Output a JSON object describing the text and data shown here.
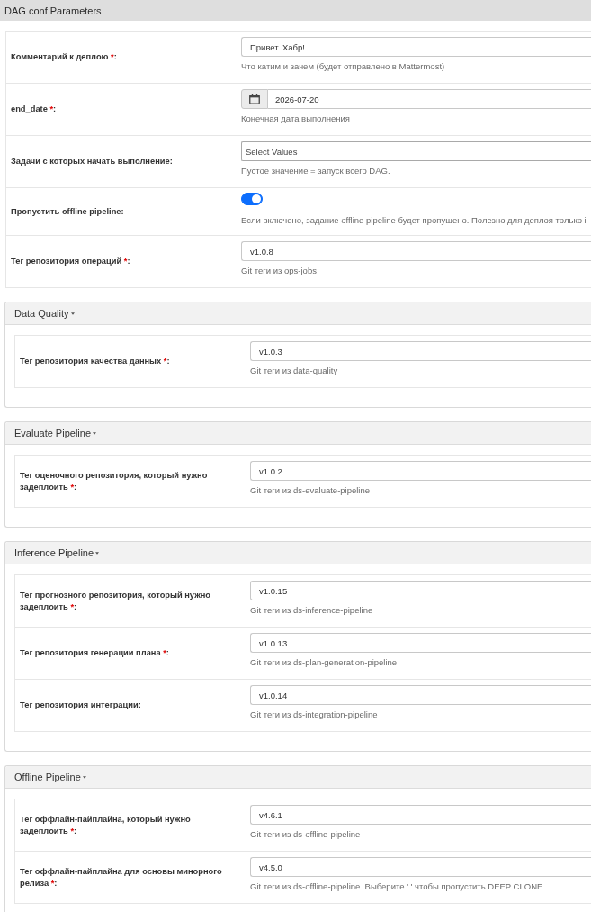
{
  "title": "DAG conf Parameters",
  "fields": [
    {
      "label": "Комментарий к деплою",
      "required_mark": "*",
      "colon": ":",
      "kind": "text",
      "value": "Привет. Хабр!",
      "hint": "Что катим и зачем (будет отправлено в Mattermost)"
    },
    {
      "label": "end_date",
      "required_mark": "*",
      "colon": ":",
      "kind": "date",
      "value": "2026-07-20",
      "hint": "Конечная дата выполнения"
    },
    {
      "label": "Задачи с которых начать выполнение",
      "colon": ":",
      "kind": "select",
      "placeholder": "Select Values",
      "hint": "Пустое значение = запуск всего DAG."
    },
    {
      "label": "Пропустить offline pipeline",
      "colon": ":",
      "kind": "toggle",
      "on": true,
      "hint": "Если включено, задание offline pipeline будет пропущено. Полезно для деплоя только i"
    },
    {
      "label": "Тег репозитория операций",
      "required_mark": "*",
      "colon": ":",
      "kind": "text",
      "value": "v1.0.8",
      "hint": "Git теги из ops-jobs"
    }
  ],
  "sections": [
    {
      "title": "Data Quality",
      "expanded": true,
      "fields": [
        {
          "label": "Тег репозитория качества данных",
          "required_mark": "*",
          "colon": ":",
          "kind": "text",
          "value": "v1.0.3",
          "hint": "Git теги из data-quality"
        }
      ]
    },
    {
      "title": "Evaluate Pipeline",
      "expanded": true,
      "fields": [
        {
          "label": "Тег оценочного репозитория, который нужно задеплоить",
          "required_mark": "*",
          "colon": ":",
          "kind": "text",
          "value": "v1.0.2",
          "hint": "Git теги из ds-evaluate-pipeline"
        }
      ]
    },
    {
      "title": "Inference Pipeline",
      "expanded": true,
      "fields": [
        {
          "label": "Тег прогнозного репозитория, который нужно задеплоить",
          "required_mark": "*",
          "colon": ":",
          "kind": "text",
          "value": "v1.0.15",
          "hint": "Git теги из ds-inference-pipeline"
        },
        {
          "label": "Тег репозитория генерации плана",
          "required_mark": "*",
          "colon": ":",
          "kind": "text",
          "value": "v1.0.13",
          "hint": "Git теги из ds-plan-generation-pipeline"
        },
        {
          "label": "Тег репозитория интеграции",
          "colon": ":",
          "kind": "text",
          "value": "v1.0.14",
          "hint": "Git теги из ds-integration-pipeline"
        }
      ]
    },
    {
      "title": "Offline Pipeline",
      "expanded": true,
      "fields": [
        {
          "label": "Тег оффлайн-пайплайна, который нужно задеплоить",
          "required_mark": "*",
          "colon": ":",
          "kind": "text",
          "value": "v4.6.1",
          "hint": "Git теги из ds-offline-pipeline"
        },
        {
          "label": "Тег оффлайн-пайплайна для основы минорного релиза",
          "required_mark": "*",
          "colon": ":",
          "kind": "text",
          "value": "v4.5.0",
          "hint": "Git теги из ds-offline-pipeline. Выберите ' ' чтобы пропустить DEEP CLONE"
        }
      ]
    }
  ]
}
